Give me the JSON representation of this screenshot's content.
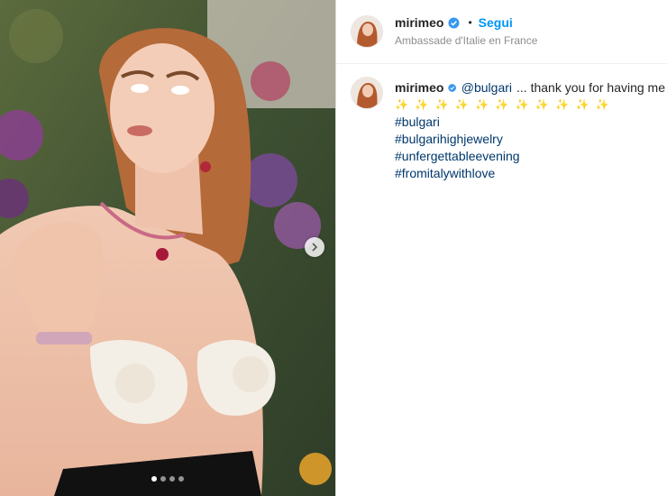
{
  "post": {
    "username": "mirimeo",
    "follow_label": "Segui",
    "separator": "•",
    "location": "Ambassade d'Italie en France"
  },
  "caption": {
    "username": "mirimeo",
    "mention": "@bulgari",
    "text": "... thank you for having me",
    "sparkles": "✨ ✨ ✨ ✨ ✨ ✨ ✨ ✨ ✨ ✨ ✨",
    "hashtags": [
      "#bulgari",
      "#bulgarihighjewelry",
      "#unfergettableevening",
      "#fromitalywithlove"
    ]
  },
  "carousel": {
    "slide_count": 4,
    "current_slide": 1
  },
  "colors": {
    "link": "#00376b",
    "follow": "#0095f6",
    "verified": "#3897f0",
    "muted": "#8e8e8e"
  },
  "icons": {
    "verified": "verified-badge-icon",
    "next": "chevron-right-icon"
  }
}
